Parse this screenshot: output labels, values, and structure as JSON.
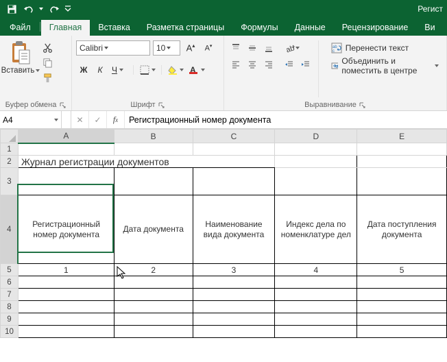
{
  "qat": {
    "save": "save-icon",
    "undo": "undo-icon",
    "redo": "redo-icon",
    "customize": "customize-dd"
  },
  "title": "Регист",
  "tabs": {
    "file": "Файл",
    "home": "Главная",
    "insert": "Вставка",
    "pagelayout": "Разметка страницы",
    "formulas": "Формулы",
    "data": "Данные",
    "review": "Рецензирование",
    "view": "Ви"
  },
  "ribbon": {
    "clipboard": {
      "paste": "Вставить",
      "label": "Буфер обмена"
    },
    "font": {
      "name": "Calibri",
      "size": "10",
      "bold": "Ж",
      "italic": "К",
      "underline": "Ч",
      "label": "Шрифт"
    },
    "alignment": {
      "wrap": "Перенести текст",
      "merge": "Объединить и поместить в центре",
      "label": "Выравнивание"
    }
  },
  "namebox": "A4",
  "formula": "Регистрационный номер документа",
  "sheet": {
    "cols": [
      "A",
      "B",
      "C",
      "D",
      "E"
    ],
    "title": "Журнал регистрации документов",
    "headers": [
      "Регистрационный номер документа",
      "Дата документа",
      "Наименование вида документа",
      "Индекс дела по номенклатуре дел",
      "Дата поступления документа"
    ],
    "nums": [
      "1",
      "2",
      "3",
      "4",
      "5"
    ],
    "row_labels": [
      "1",
      "2",
      "3",
      "4",
      "5",
      "6",
      "7",
      "8",
      "9",
      "10"
    ]
  }
}
